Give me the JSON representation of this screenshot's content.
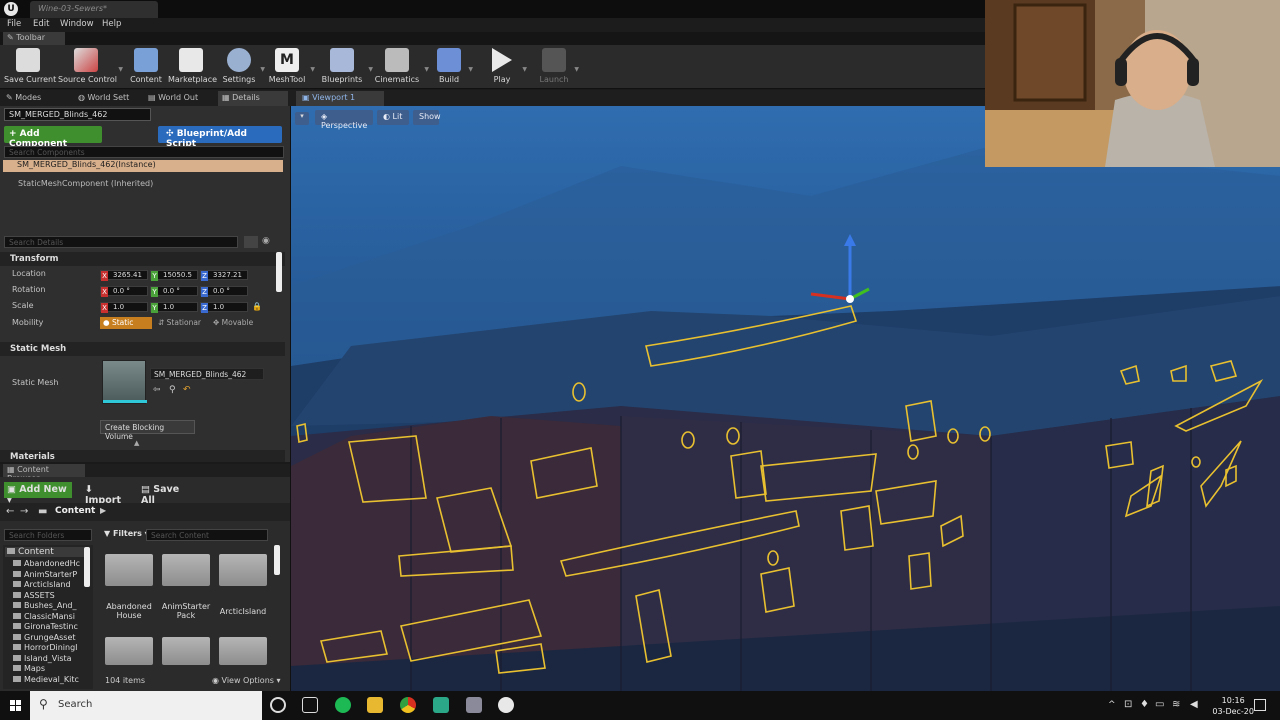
{
  "titlebar": {
    "tab_title": "Wine-03-Sewers*"
  },
  "menu": [
    "File",
    "Edit",
    "Window",
    "Help"
  ],
  "toolbar_tab": "Toolbar",
  "toolbar": [
    "Save Current",
    "Source Control",
    "Content",
    "Marketplace",
    "Settings",
    "MeshTool",
    "Blueprints",
    "Cinematics",
    "Build",
    "Play",
    "Launch"
  ],
  "panel_tabs": [
    "Modes",
    "World Sett",
    "World Out",
    "Details"
  ],
  "details": {
    "actor_name": "SM_MERGED_Blinds_462",
    "add_component": "+ Add Component",
    "blueprint": "Blueprint/Add Script",
    "search_components": "Search Components",
    "selected_instance": "SM_MERGED_Blinds_462(Instance)",
    "component": "StaticMeshComponent (Inherited)",
    "search_details": "Search Details",
    "transform_header": "Transform",
    "location_label": "Location",
    "rotation_label": "Rotation",
    "scale_label": "Scale",
    "mobility_label": "Mobility",
    "location": [
      "3265.41",
      "15050.5",
      "3327.21"
    ],
    "rotation": [
      "0.0 °",
      "0.0 °",
      "0.0 °"
    ],
    "scale": [
      "1.0",
      "1.0",
      "1.0"
    ],
    "mobility": [
      "Static",
      "Stationar",
      "Movable"
    ],
    "static_mesh_header": "Static Mesh",
    "static_mesh_label": "Static Mesh",
    "mesh_name": "SM_MERGED_Blinds_462",
    "create_blocking": "Create Blocking Volume",
    "materials_header": "Materials"
  },
  "content_browser": {
    "tab": "Content Browser",
    "add_new": "Add New",
    "import": "Import",
    "save_all": "Save All",
    "breadcrumb": "Content",
    "search_folders": "Search Folders",
    "filters": "Filters",
    "search_content": "Search Content",
    "tree_root": "Content",
    "tree": [
      "AbandonedHc",
      "AnimStarterP",
      "ArcticIsland",
      "ASSETS",
      "Bushes_And_",
      "ClassicMansi",
      "GironaTestinc",
      "GrungeAsset",
      "HorrorDiningI",
      "Island_Vista",
      "Maps",
      "Medieval_Kitc"
    ],
    "folders": [
      {
        "line1": "Abandoned",
        "line2": "House"
      },
      {
        "line1": "AnimStarter",
        "line2": "Pack"
      },
      {
        "line1": "ArcticIsland",
        "line2": ""
      }
    ],
    "item_count": "104 items",
    "view_options": "View Options"
  },
  "viewport": {
    "tab": "Viewport 1",
    "perspective": "Perspective",
    "lit": "Lit",
    "show": "Show"
  },
  "taskbar": {
    "search": "Search",
    "time": "10:16",
    "date": "03-Dec-20"
  },
  "colors": {
    "accent_green": "#3f8f2e",
    "accent_blue": "#2a6bbd",
    "selection": "#d9b08c",
    "outline": "#e8c030"
  }
}
